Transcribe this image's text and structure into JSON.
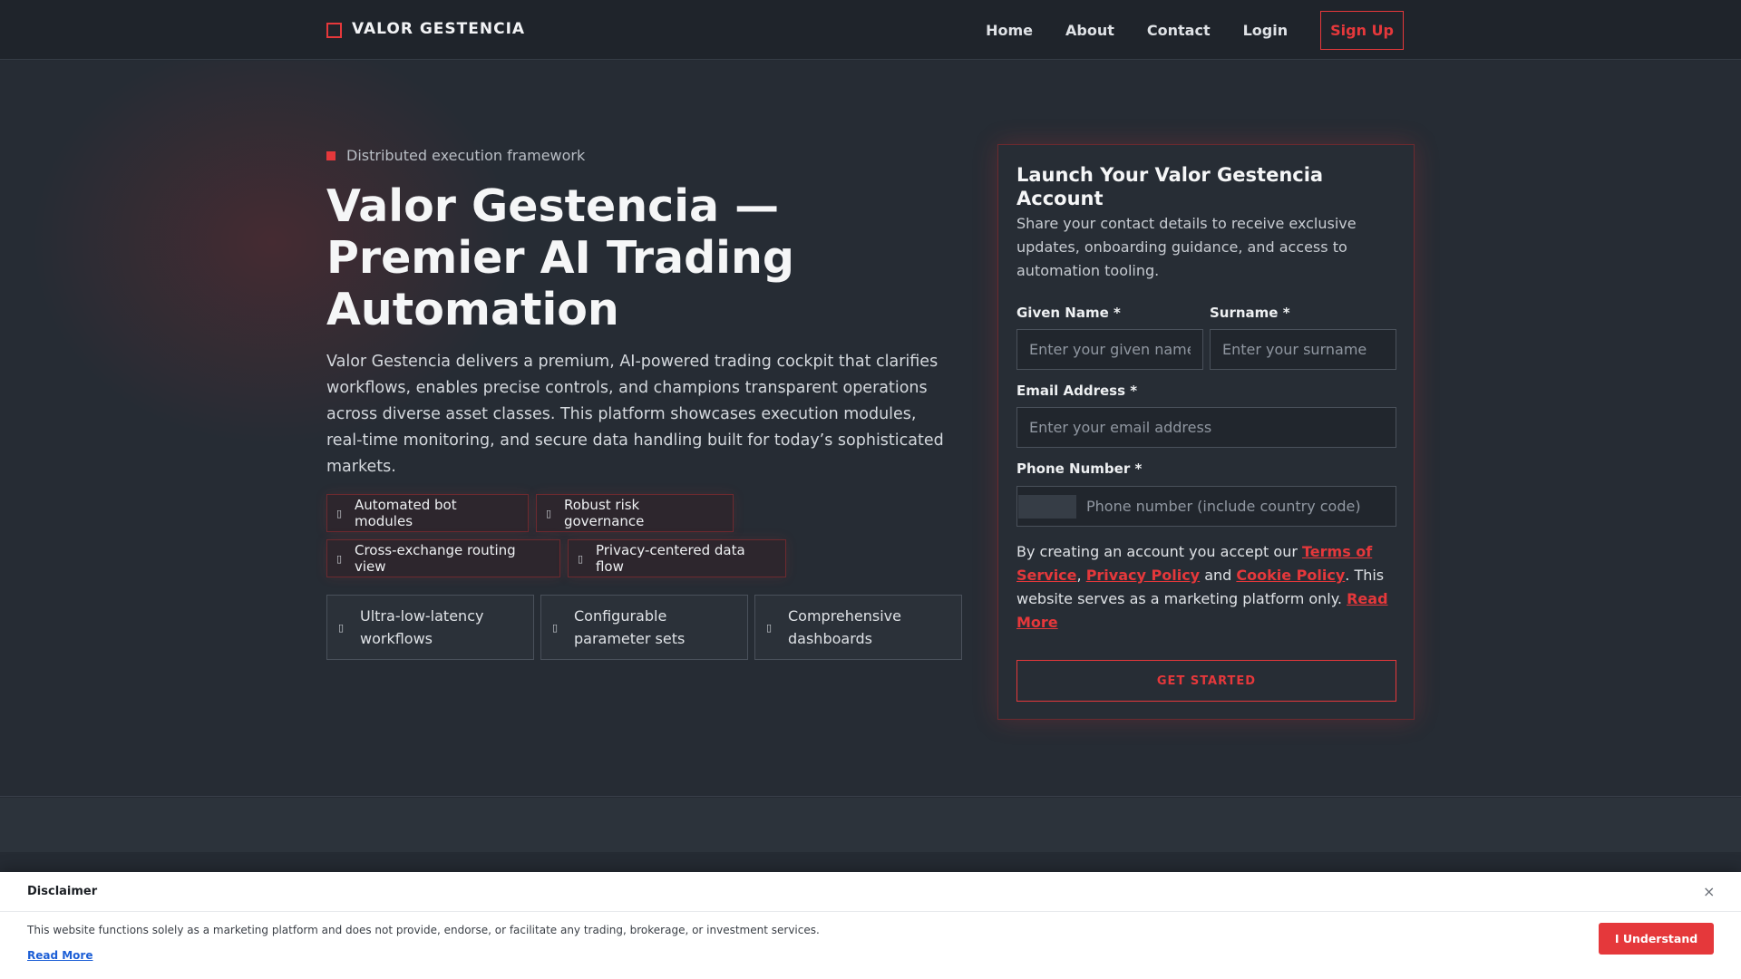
{
  "nav": {
    "brand": "VALOR GESTENCIA",
    "links": [
      "Home",
      "About",
      "Contact",
      "Login"
    ],
    "signup": "Sign Up"
  },
  "hero": {
    "eyebrow": "Distributed execution framework",
    "headline": "Valor Gestencia — Premier AI Trading Automation",
    "lead": "Valor Gestencia delivers a premium, AI-powered trading cockpit that clarifies workflows, enables precise controls, and champions transparent operations across diverse asset classes. This platform showcases execution modules, real-time monitoring, and secure data handling built for today’s sophisticated markets.",
    "chips": [
      {
        "icon": "bot-icon",
        "label": "Automated bot modules"
      },
      {
        "icon": "shield-icon",
        "label": "Robust risk governance"
      },
      {
        "icon": "route-icon",
        "label": "Cross-exchange routing view"
      },
      {
        "icon": "lock-icon",
        "label": "Privacy-centered data flow"
      }
    ],
    "features": [
      {
        "icon": "bolt-icon",
        "label": "Ultra-low-latency workflows"
      },
      {
        "icon": "sliders-icon",
        "label": "Configurable parameter sets"
      },
      {
        "icon": "dashboard-icon",
        "label": "Comprehensive dashboards"
      }
    ]
  },
  "form": {
    "title": "Launch Your Valor Gestencia Account",
    "subtitle": "Share your contact details to receive exclusive updates, onboarding guidance, and access to automation tooling.",
    "given_label": "Given Name *",
    "given_placeholder": "Enter your given name",
    "surname_label": "Surname *",
    "surname_placeholder": "Enter your surname",
    "email_label": "Email Address *",
    "email_placeholder": "Enter your email address",
    "phone_label": "Phone Number *",
    "phone_placeholder": "Phone number (include country code)",
    "consent_pre": "By creating an account you accept our ",
    "terms": "Terms of Service",
    "sep1": ", ",
    "privacy": "Privacy Policy",
    "and": " and ",
    "cookie": "Cookie Policy",
    "consent_post": ". This website serves as a marketing platform only. ",
    "read_more": "Read More",
    "cta": "GET STARTED"
  },
  "disclaimer": {
    "title": "Disclaimer",
    "close": "×",
    "text": "This website functions solely as a marketing platform and does not provide, endorse, or facilitate any trading, brokerage, or investment services.",
    "read_more": "Read More",
    "button": "I Understand"
  },
  "colors": {
    "accent": "#e5383b",
    "background": "#262c34",
    "nav": "#1f242b",
    "link": "#1d5fd6"
  }
}
